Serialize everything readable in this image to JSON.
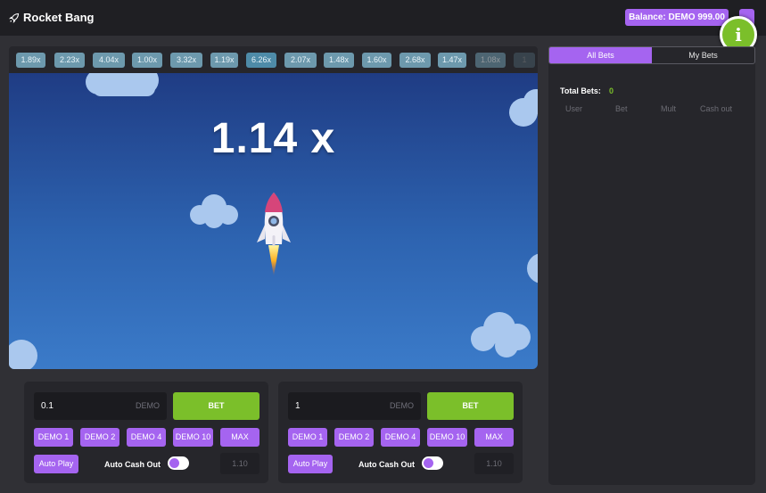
{
  "header": {
    "title": "Rocket Bang",
    "balance": "Balance: DEMO 999.00"
  },
  "colors": {
    "accent": "#a564f0",
    "green": "#7bbf2a",
    "history_pill": "#6d99ad"
  },
  "history": [
    "1.89x",
    "2.23x",
    "4.04x",
    "1.00x",
    "3.32x",
    "1.19x",
    "6.26x",
    "2.07x",
    "1.48x",
    "1.60x",
    "2.68x",
    "1.47x",
    "1.08x",
    "1"
  ],
  "game": {
    "multiplier": "1.14 x"
  },
  "sidebar": {
    "tabs": [
      "All Bets",
      "My Bets"
    ],
    "total_bets_label": "Total Bets:",
    "total_bets_value": "0",
    "columns": [
      "User",
      "Bet",
      "Mult",
      "Cash out"
    ]
  },
  "panels": [
    {
      "amount": "0.1",
      "currency": "DEMO",
      "bet_label": "BET",
      "quick": [
        "DEMO 1",
        "DEMO 2",
        "DEMO 4",
        "DEMO 10",
        "MAX"
      ],
      "auto_play": "Auto Play",
      "auto_cash_out": "Auto Cash Out",
      "cash_out_value": "1.10"
    },
    {
      "amount": "1",
      "currency": "DEMO",
      "bet_label": "BET",
      "quick": [
        "DEMO 1",
        "DEMO 2",
        "DEMO 4",
        "DEMO 10",
        "MAX"
      ],
      "auto_play": "Auto Play",
      "auto_cash_out": "Auto Cash Out",
      "cash_out_value": "1.10"
    }
  ]
}
